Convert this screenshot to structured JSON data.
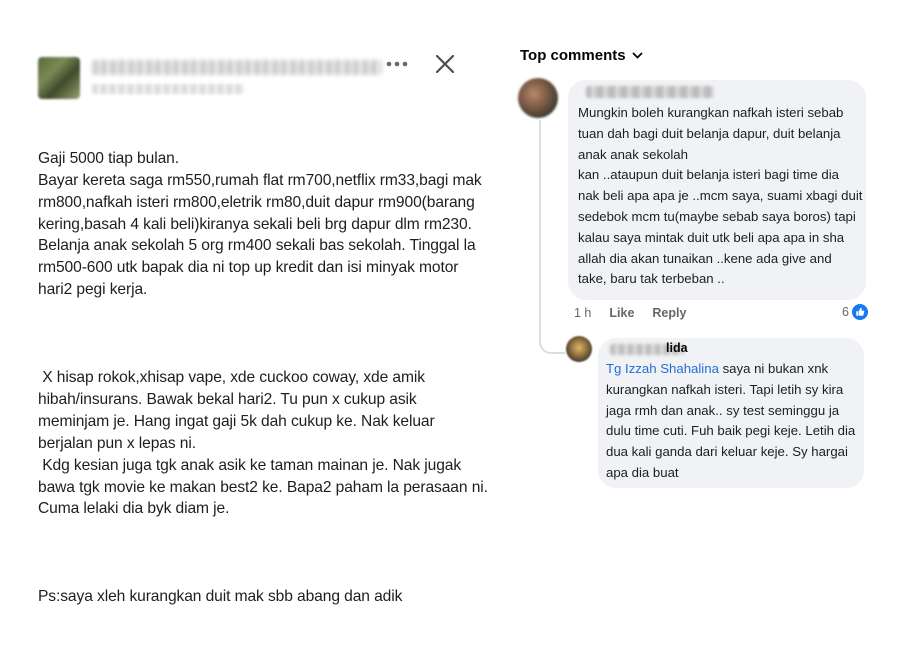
{
  "post": {
    "more_icon": "more-horizontal-icon",
    "close_icon": "close-icon",
    "body": [
      "Gaji 5000 tiap bulan.\nBayar kereta saga rm550,rumah flat rm700,netflix rm33,bagi mak rm800,nafkah isteri rm800,eletrik rm80,duit dapur rm900(barang kering,basah 4 kali beli)kiranya sekali beli brg dapur dlm rm230. Belanja anak sekolah 5 org rm400 sekali bas sekolah. Tinggal la rm500-600 utk bapak dia ni top up kredit dan isi minyak motor hari2 pegi kerja.",
      " X hisap rokok,xhisap vape, xde cuckoo coway, xde amik hibah/insurans. Bawak bekal hari2. Tu pun x cukup asik meminjam je. Hang ingat gaji 5k dah cukup ke. Nak keluar berjalan pun x lepas ni.\n Kdg kesian juga tgk anak asik ke taman mainan je. Nak jugak bawa tgk movie ke makan best2 ke. Bapa2 paham la perasaan ni. Cuma lelaki dia byk diam je.",
      "Ps:saya xleh kurangkan duit mak sbb abang dan adik"
    ]
  },
  "comments": {
    "header": "Top comments",
    "header_icon": "chevron-down-icon",
    "first": {
      "text": "Mungkin boleh kurangkan nafkah isteri sebab tuan dah bagi duit belanja dapur, duit belanja anak anak sekolah\nkan ..ataupun duit belanja isteri bagi time dia nak beli apa apa je ..mcm saya, suami xbagi duit sedebok mcm tu(maybe sebab saya boros) tapi kalau saya mintak duit utk beli apa apa in sha allah dia akan tunaikan ..kene ada give and take, baru tak terbeban ..",
      "time": "1 h",
      "like_label": "Like",
      "reply_label": "Reply",
      "reaction_count": "6",
      "reaction_icon": "like-reaction-icon"
    },
    "reply": {
      "name_tail": "lida",
      "mention": "Tg Izzah Shahalina",
      "text": " saya ni bukan xnk kurangkan nafkah isteri. Tapi letih sy kira jaga rmh dan anak.. sy test seminggu ja dulu time cuti. Fuh baik pegi keje. Letih dia dua kali ganda dari keluar keje. Sy hargai apa dia buat"
    }
  }
}
